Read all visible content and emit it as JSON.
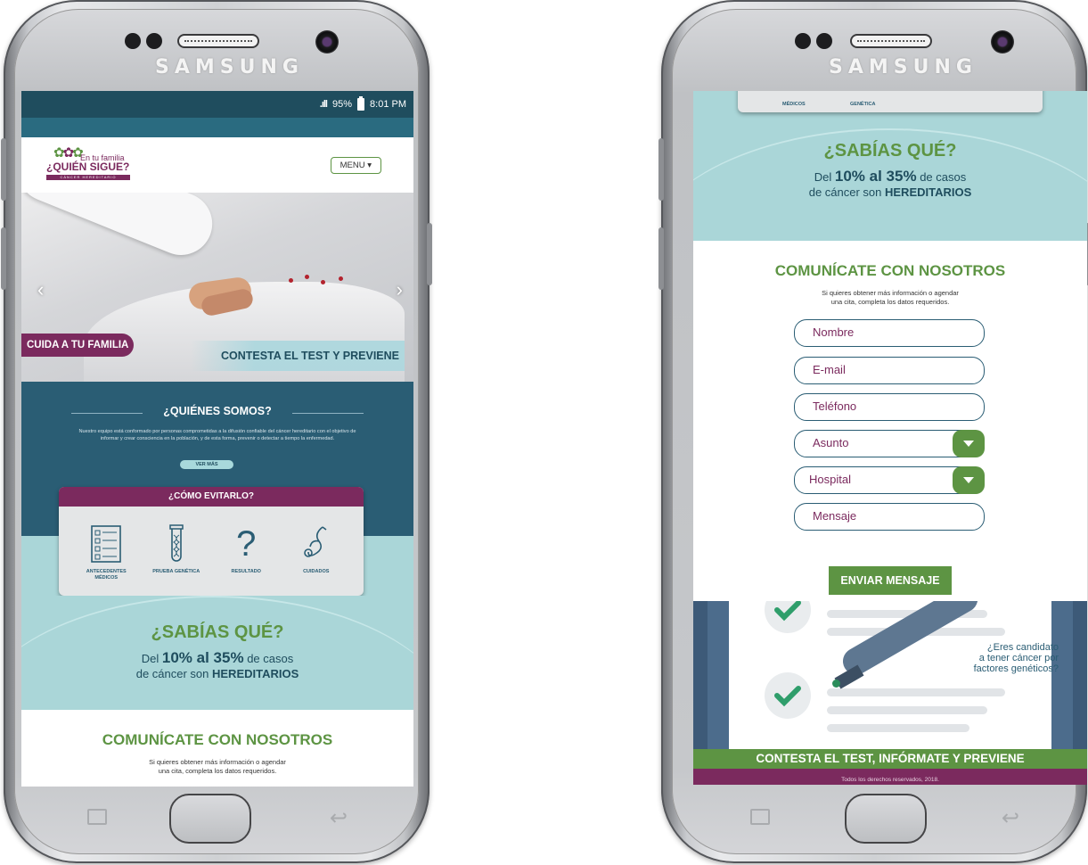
{
  "device": {
    "brand": "SAMSUNG"
  },
  "status_bar": {
    "signal": ".ıll",
    "battery_percent": "95%",
    "time": "8:01 PM"
  },
  "header": {
    "logo_small": "En tu familia",
    "logo_main": "¿QUIÉN SIGUE?",
    "logo_strip": "CÁNCER HEREDITARIO",
    "menu_label": "MENU ▾"
  },
  "hero": {
    "prev_arrow": "‹",
    "next_arrow": "›",
    "pill_label": "CUIDA A TU FAMILIA",
    "cta_label": "CONTESTA EL TEST Y PREVIENE"
  },
  "quienes": {
    "title": "¿QUIÉNES SOMOS?",
    "text": "Nuestro equipo está conformado por personas comprometidas a la difusión confiable del cáncer hereditario con el objetivo de informar y crear consciencia en la población, y de esta forma, prevenir o detectar a tiempo la enfermedad.",
    "button": "VER MÁS"
  },
  "evitar": {
    "title": "¿CÓMO EVITARLO?",
    "items": [
      {
        "label": "ANTECEDENTES MÉDICOS",
        "icon": "checklist-icon"
      },
      {
        "label": "PRUEBA GENÉTICA",
        "icon": "test-tube-icon"
      },
      {
        "label": "RESULTADO",
        "icon": "question-icon"
      },
      {
        "label": "CUIDADOS",
        "icon": "stethoscope-icon"
      }
    ],
    "card_bottom_labels": [
      "MÉDICOS",
      "GENÉTICA"
    ]
  },
  "sabias": {
    "title": "¿SABÍAS QUÉ?",
    "line1_pre": "Del ",
    "line1_strong": "10% al 35%",
    "line1_post": " de casos",
    "line2_pre": "de cáncer son ",
    "line2_strong": "HEREDITARIOS"
  },
  "contacto": {
    "title": "COMUNÍCATE CON NOSOTROS",
    "text_line1": "Si quieres obtener más información o agendar",
    "text_line2": "una cita, completa los datos requeridos.",
    "fields": {
      "nombre": "Nombre",
      "email": "E-mail",
      "telefono": "Teléfono",
      "asunto": "Asunto",
      "hospital": "Hospital",
      "mensaje": "Mensaje"
    },
    "send_button": "ENVIAR MENSAJE"
  },
  "illustration": {
    "question_line1": "¿Eres candidato",
    "question_line2": "a tener cáncer por",
    "question_line3": "factores genéticos?"
  },
  "cta_banner": "CONTESTA EL TEST, INFÓRMATE Y PREVIENE",
  "footer": "Todos los derechos reservados, 2018.",
  "colors": {
    "teal_dark": "#1f4d5e",
    "teal": "#2a5d74",
    "aqua": "#aad6d8",
    "green": "#5d9443",
    "plum": "#7b2a5e"
  }
}
